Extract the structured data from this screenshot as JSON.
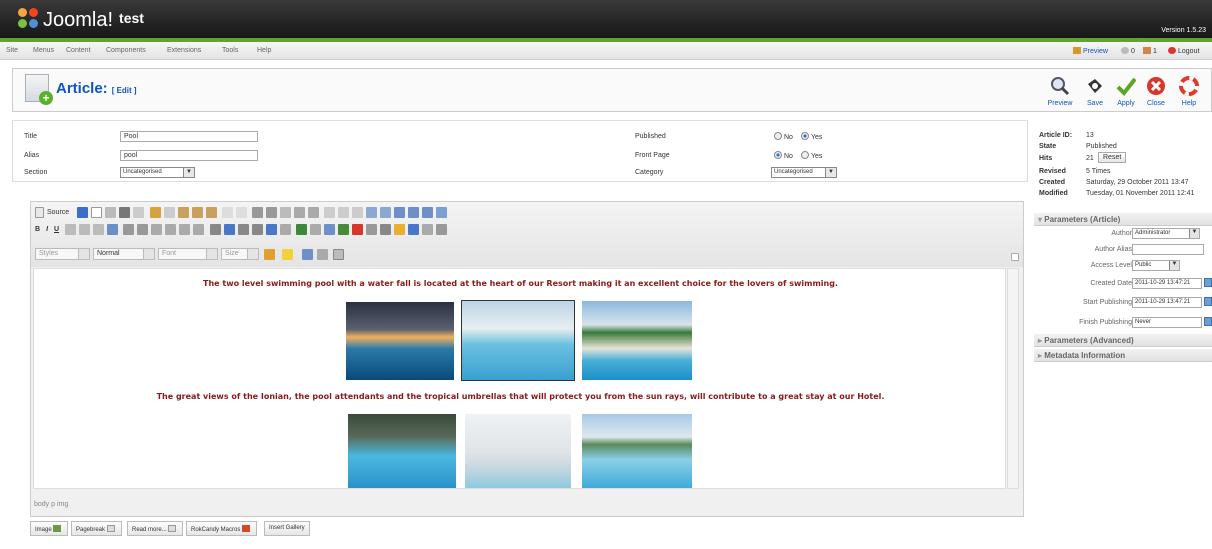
{
  "app": {
    "logo_text": "Joomla!",
    "site_name": "test",
    "version": "Version 1.5.23"
  },
  "menu": {
    "items": [
      "Site",
      "Menus",
      "Content",
      "Components",
      "Extensions",
      "Tools",
      "Help"
    ]
  },
  "status": {
    "preview": "Preview",
    "visitors": "0",
    "messages": "1",
    "logout": "Logout"
  },
  "header": {
    "title": "Article:",
    "subtitle": "[ Edit ]"
  },
  "toolbar": {
    "buttons": [
      {
        "label": "Preview",
        "icon": "magnifier-icon"
      },
      {
        "label": "Save",
        "icon": "save-icon"
      },
      {
        "label": "Apply",
        "icon": "checkmark-icon"
      },
      {
        "label": "Close",
        "icon": "close-icon"
      },
      {
        "label": "Help",
        "icon": "help-lifebuoy-icon"
      }
    ]
  },
  "form": {
    "title_label": "Title",
    "title_value": "Pool",
    "alias_label": "Alias",
    "alias_value": "pool",
    "section_label": "Section",
    "section_value": "Uncategorised",
    "published_label": "Published",
    "front_page_label": "Front Page",
    "category_label": "Category",
    "category_value": "Uncategorised",
    "no_label": "No",
    "yes_label": "Yes",
    "published": "Yes",
    "front_page": "No"
  },
  "info": {
    "article_id_label": "Article ID:",
    "article_id": "13",
    "state_label": "State",
    "state": "Published",
    "hits_label": "Hits",
    "hits": "21",
    "reset_label": "Reset",
    "revised_label": "Revised",
    "revised": "5 Times",
    "created_label": "Created",
    "created": "Saturday, 29 October 2011 13:47",
    "modified_label": "Modified",
    "modified": "Tuesday, 01 November 2011 12:41"
  },
  "editor": {
    "source_label": "Source",
    "styles_placeholder": "Styles",
    "format_value": "Normal",
    "font_placeholder": "Font",
    "size_placeholder": "Size",
    "paragraph1": "The two level swimming pool with a water fall is located at the heart of our Resort making it an excellent choice for the lovers of swimming.",
    "paragraph2": "The great views of the Ionian, the pool attendants and the tropical umbrellas that will protect you from the sun rays, will contribute to a great stay at our Hotel.",
    "path": "body  p  img"
  },
  "bottom_buttons": [
    "Image",
    "Pagebreak",
    "Read more...",
    "RokCandy Macros",
    "Insert Gallery"
  ],
  "params": {
    "article_header": "Parameters (Article)",
    "author_label": "Author",
    "author_value": "Administrator",
    "author_alias_label": "Author Alias",
    "author_alias_value": "",
    "access_label": "Access Level",
    "access_value": "Public",
    "created_date_label": "Created Date",
    "created_date_value": "2011-10-29 13:47:21",
    "start_pub_label": "Start Publishing",
    "start_pub_value": "2011-10-29 13:47:21",
    "finish_pub_label": "Finish Publishing",
    "finish_pub_value": "Never",
    "advanced_header": "Parameters (Advanced)",
    "metadata_header": "Metadata Information"
  },
  "colors": {
    "accent": "#0b55c4",
    "topbar": "#1e1e1e",
    "green_strip": "#62a32f",
    "paragraph_text": "#8b1a1a"
  }
}
